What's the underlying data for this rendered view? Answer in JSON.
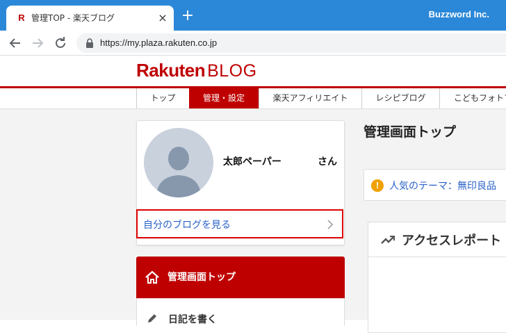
{
  "browser": {
    "tab_title": "管理TOP - 楽天ブログ",
    "favicon_letter": "R",
    "tab_close": "×",
    "new_tab": "+",
    "profile_name": "Buzzword Inc.",
    "url": "https://my.plaza.rakuten.co.jp",
    "titlebar_color": "#2b88d8"
  },
  "site": {
    "logo_main": "Rakuten",
    "logo_sub": "BLOG",
    "brand_color": "#bf0000",
    "nav": [
      {
        "label": "トップ",
        "active": false
      },
      {
        "label": "管理・設定",
        "active": true
      },
      {
        "label": "楽天アフィリエイト",
        "active": false
      },
      {
        "label": "レシピブログ",
        "active": false
      },
      {
        "label": "こどもフォトブック",
        "active": false
      }
    ]
  },
  "profile_card": {
    "user_name": "太郎ペーパー",
    "honorific": "さん",
    "blog_link": "自分のブログを見る"
  },
  "side_menu": {
    "active_label": "管理画面トップ",
    "next_label": "日記を書く"
  },
  "main": {
    "title": "管理画面トップ",
    "notice_text": "人気のテーマ：無印良品",
    "access_title": "アクセスレポート"
  }
}
